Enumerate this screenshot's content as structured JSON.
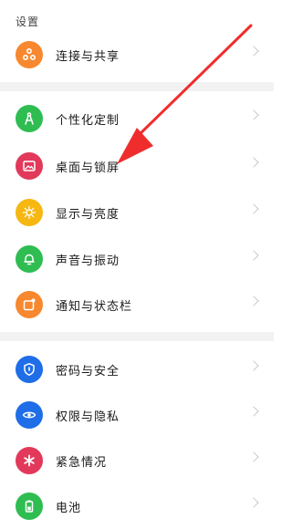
{
  "header": {
    "title": "设置"
  },
  "colors": {
    "orange": "#f7882f",
    "green": "#2fbd52",
    "red": "#e2395b",
    "yellow": "#f6b712",
    "blue": "#1f6ee8",
    "annotation_arrow": "#f02d2d"
  },
  "groups": [
    {
      "items": [
        {
          "label": "连接与共享",
          "icon": "share-icon",
          "color": "#f7882f"
        }
      ]
    },
    {
      "items": [
        {
          "label": "个性化定制",
          "icon": "compass-icon",
          "color": "#2fbd52"
        },
        {
          "label": "桌面与锁屏",
          "icon": "wallpaper-icon",
          "color": "#e2395b"
        },
        {
          "label": "显示与亮度",
          "icon": "brightness-icon",
          "color": "#f6b712"
        },
        {
          "label": "声音与振动",
          "icon": "bell-icon",
          "color": "#2fbd52"
        },
        {
          "label": "通知与状态栏",
          "icon": "notification-icon",
          "color": "#f7882f"
        }
      ]
    },
    {
      "items": [
        {
          "label": "密码与安全",
          "icon": "shield-icon",
          "color": "#1f6ee8"
        },
        {
          "label": "权限与隐私",
          "icon": "privacy-eye-icon",
          "color": "#1f6ee8"
        },
        {
          "label": "紧急情况",
          "icon": "asterisk-icon",
          "color": "#e2395b"
        },
        {
          "label": "电池",
          "icon": "battery-icon",
          "color": "#2fbd52"
        }
      ]
    }
  ]
}
